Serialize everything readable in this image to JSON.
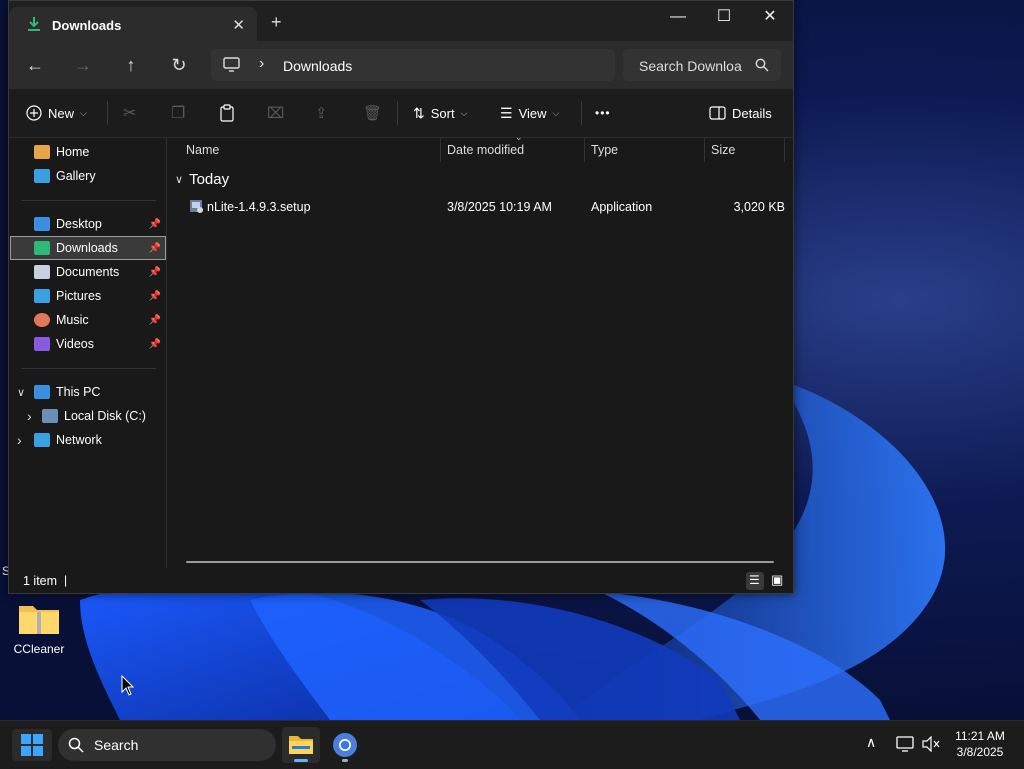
{
  "window": {
    "tab_title": "Downloads",
    "tab_close_glyph": "✕",
    "new_tab_glyph": "+",
    "controls": {
      "minimize": "—",
      "maximize": "☐",
      "close": "✕"
    }
  },
  "nav": {
    "back_glyph": "←",
    "forward_glyph": "→",
    "up_glyph": "↑",
    "refresh_glyph": "↻",
    "breadcrumb_sep": "›",
    "breadcrumb": "Downloads",
    "search_placeholder": "Search Downloa"
  },
  "toolbar": {
    "new_label": "New",
    "sort_label": "Sort",
    "view_label": "View",
    "more_label": "•••",
    "details_label": "Details",
    "icons": [
      "cut-icon",
      "copy-icon",
      "paste-icon",
      "rename-icon",
      "share-icon",
      "delete-icon"
    ]
  },
  "sidebar": {
    "quick": [
      {
        "label": "Home",
        "icon": "home-icon",
        "color": "#e8a44a"
      },
      {
        "label": "Gallery",
        "icon": "gallery-icon",
        "color": "#3aa0e0"
      }
    ],
    "pinned": [
      {
        "label": "Desktop",
        "icon": "desktop-icon",
        "color": "#3b8fe0",
        "selected": false
      },
      {
        "label": "Downloads",
        "icon": "download-icon",
        "color": "#2fb87a",
        "selected": true
      },
      {
        "label": "Documents",
        "icon": "documents-icon",
        "color": "#c7d0de",
        "selected": false
      },
      {
        "label": "Pictures",
        "icon": "pictures-icon",
        "color": "#3aa0e0",
        "selected": false
      },
      {
        "label": "Music",
        "icon": "music-icon",
        "color": "#e0785a",
        "selected": false
      },
      {
        "label": "Videos",
        "icon": "videos-icon",
        "color": "#8a5ae0",
        "selected": false
      }
    ],
    "pin_glyph": "📌",
    "tree": [
      {
        "label": "This PC",
        "icon": "this-pc-icon",
        "expander": "∨"
      },
      {
        "label": "Local Disk (C:)",
        "icon": "local-disk-icon",
        "expander": "›"
      },
      {
        "label": "Network",
        "icon": "network-icon",
        "expander": "›"
      }
    ]
  },
  "columns": [
    "Name",
    "Date modified",
    "Type",
    "Size"
  ],
  "group": {
    "label": "Today",
    "chevron": "∨"
  },
  "files": [
    {
      "name": "nLite-1.4.9.3.setup",
      "date": "3/8/2025 10:19 AM",
      "type": "Application",
      "size": "3,020 KB"
    }
  ],
  "status": {
    "count": "1 item",
    "divider": "|"
  },
  "desktop": {
    "icon_label": "CCleaner",
    "edge_char": "S"
  },
  "taskbar": {
    "search_label": "Search",
    "time": "11:21 AM",
    "date": "3/8/2025",
    "tray_chevron": "∧"
  }
}
